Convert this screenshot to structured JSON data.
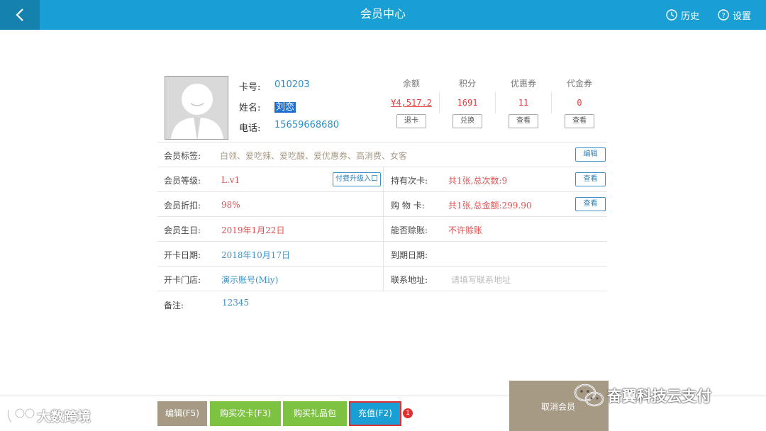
{
  "header": {
    "title": "会员中心",
    "history_label": "历史",
    "settings_label": "设置"
  },
  "member": {
    "card_label": "卡号:",
    "card_no": "010203",
    "name_label": "姓名:",
    "name": "刘恋",
    "phone_label": "电话:",
    "phone": "15659668680"
  },
  "stats": [
    {
      "title": "余额",
      "value": "¥4,517.2",
      "button": "退卡"
    },
    {
      "title": "积分",
      "value": "1691",
      "button": "兑换"
    },
    {
      "title": "优惠券",
      "value": "11",
      "button": "查看"
    },
    {
      "title": "代金券",
      "value": "0",
      "button": "查看"
    }
  ],
  "details": {
    "tags_label": "会员标签:",
    "tags": "白领、爱吃辣、爱吃酸、爱优惠券、高消费、女客",
    "tags_edit": "编辑",
    "level_label": "会员等级:",
    "level": "L.v1",
    "upgrade_button": "付费升级入口",
    "count_card_label": "持有次卡:",
    "count_card": "共1张,总次数:9",
    "count_card_view": "查看",
    "discount_label": "会员折扣:",
    "discount": "98%",
    "shop_card_label": "购 物 卡:",
    "shop_card": "共1张,总金额:299.90",
    "shop_card_view": "查看",
    "birthday_label": "会员生日:",
    "birthday": "2019年1月22日",
    "credit_label": "能否赊账:",
    "credit": "不许赊账",
    "open_date_label": "开卡日期:",
    "open_date": "2018年10月17日",
    "expire_label": "到期日期:",
    "expire": "",
    "store_label": "开卡门店:",
    "store": "演示账号(Miy)",
    "address_label": "联系地址:",
    "address_placeholder": "请填写联系地址",
    "remark_label": "备注:",
    "remark": "12345"
  },
  "footer": {
    "edit": "编辑(F5)",
    "buy_count": "购买次卡(F3)",
    "buy_gift": "购买礼品包",
    "recharge": "充值(F2)",
    "badge": "1",
    "cancel": "取消会员"
  },
  "watermarks": {
    "left": "大数跨境",
    "right": "奋翼科技云支付"
  }
}
